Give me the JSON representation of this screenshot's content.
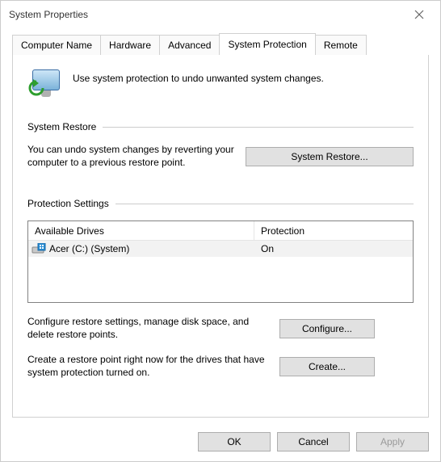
{
  "window": {
    "title": "System Properties"
  },
  "tabs": {
    "computer_name": "Computer Name",
    "hardware": "Hardware",
    "advanced": "Advanced",
    "system_protection": "System Protection",
    "remote": "Remote"
  },
  "intro": {
    "text": "Use system protection to undo unwanted system changes."
  },
  "sections": {
    "system_restore": {
      "title": "System Restore",
      "description": "You can undo system changes by reverting your computer to a previous restore point.",
      "button": "System Restore..."
    },
    "protection_settings": {
      "title": "Protection Settings",
      "columns": {
        "drives": "Available Drives",
        "protection": "Protection"
      },
      "rows": [
        {
          "name": "Acer (C:) (System)",
          "status": "On"
        }
      ],
      "configure": {
        "description": "Configure restore settings, manage disk space, and delete restore points.",
        "button": "Configure..."
      },
      "create": {
        "description": "Create a restore point right now for the drives that have system protection turned on.",
        "button": "Create..."
      }
    }
  },
  "footer": {
    "ok": "OK",
    "cancel": "Cancel",
    "apply": "Apply"
  }
}
